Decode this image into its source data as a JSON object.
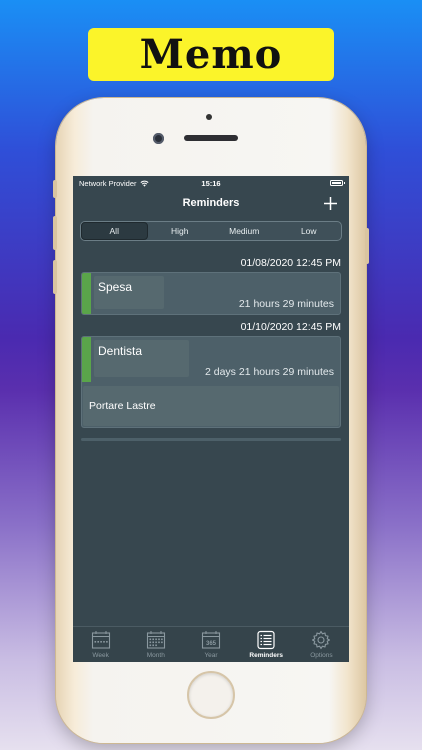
{
  "banner": {
    "title": "Memo"
  },
  "status_bar": {
    "carrier": "Network Provider",
    "time": "15:16"
  },
  "nav": {
    "title": "Reminders",
    "add_icon": "plus-icon"
  },
  "segments": [
    {
      "label": "All",
      "selected": true
    },
    {
      "label": "High",
      "selected": false
    },
    {
      "label": "Medium",
      "selected": false
    },
    {
      "label": "Low",
      "selected": false
    }
  ],
  "reminders": [
    {
      "datetime": "01/08/2020 12:45 PM",
      "title": "Spesa",
      "remaining": "21 hours 29 minutes",
      "note": "",
      "priority_color": "#5aa54a"
    },
    {
      "datetime": "01/10/2020 12:45 PM",
      "title": "Dentista",
      "remaining": "2 days 21 hours 29 minutes",
      "note": "Portare Lastre",
      "priority_color": "#5aa54a"
    }
  ],
  "tabs": [
    {
      "label": "Week",
      "icon": "calendar-week-icon",
      "active": false
    },
    {
      "label": "Month",
      "icon": "calendar-month-icon",
      "active": false
    },
    {
      "label": "Year",
      "icon": "calendar-365-icon",
      "year_text": "365",
      "active": false
    },
    {
      "label": "Reminders",
      "icon": "list-icon",
      "active": true
    },
    {
      "label": "Options",
      "icon": "gear-icon",
      "active": false
    }
  ],
  "colors": {
    "background": "#37474f",
    "card": "#4d6069",
    "accent": "#5aa54a",
    "banner": "#fbf42a"
  }
}
